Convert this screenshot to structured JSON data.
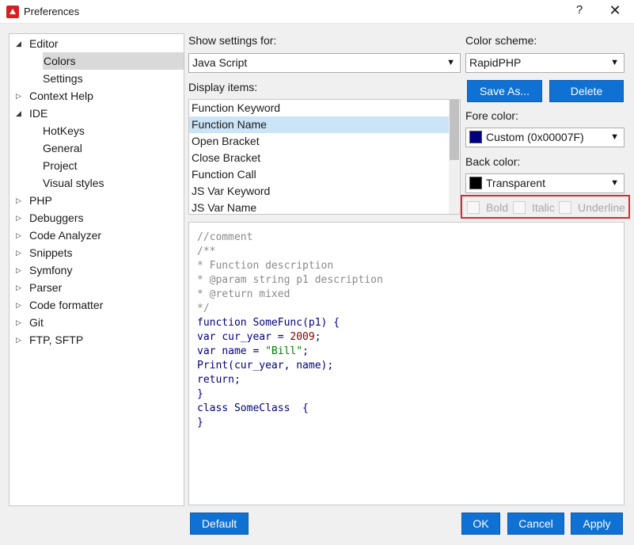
{
  "window": {
    "title": "Preferences",
    "help": "?",
    "close": "✕"
  },
  "tree": [
    {
      "label": "Editor",
      "expanded": true,
      "children": [
        {
          "label": "Colors",
          "selected": true
        },
        {
          "label": "Settings"
        }
      ]
    },
    {
      "label": "Context Help",
      "expanded": false
    },
    {
      "label": "IDE",
      "expanded": true,
      "children": [
        {
          "label": "HotKeys"
        },
        {
          "label": "General"
        },
        {
          "label": "Project"
        },
        {
          "label": "Visual styles"
        }
      ]
    },
    {
      "label": "PHP",
      "expanded": false
    },
    {
      "label": "Debuggers",
      "expanded": false
    },
    {
      "label": "Code Analyzer",
      "expanded": false
    },
    {
      "label": "Snippets",
      "expanded": false
    },
    {
      "label": "Symfony",
      "expanded": false
    },
    {
      "label": "Parser",
      "expanded": false
    },
    {
      "label": "Code formatter",
      "expanded": false
    },
    {
      "label": "Git",
      "expanded": false
    },
    {
      "label": "FTP, SFTP",
      "expanded": false
    }
  ],
  "settings": {
    "show_for_label": "Show settings for:",
    "show_for_value": "Java Script",
    "display_items_label": "Display items:",
    "display_items": [
      "Function Keyword",
      "Function Name",
      "Open Bracket",
      "Close Bracket",
      "Function Call",
      "JS Var Keyword",
      "JS Var Name"
    ],
    "selected_item_index": 1
  },
  "scheme": {
    "label": "Color scheme:",
    "value": "RapidPHP",
    "save_as": "Save As...",
    "delete": "Delete",
    "fore_label": "Fore color:",
    "fore_value": "Custom (0x00007F)",
    "fore_color": "#00007f",
    "back_label": "Back color:",
    "back_value": "Transparent",
    "back_color": "#000000",
    "bold": "Bold",
    "italic": "Italic",
    "underline": "Underline"
  },
  "preview": [
    [
      [
        "comment",
        "//comment"
      ]
    ],
    [
      [
        "comment",
        "/**"
      ]
    ],
    [
      [
        "comment",
        "* Function description"
      ]
    ],
    [
      [
        "comment",
        "* @param string p1 description"
      ]
    ],
    [
      [
        "comment",
        "* @return mixed"
      ]
    ],
    [
      [
        "comment",
        "*/"
      ]
    ],
    [
      [
        "kw",
        "function "
      ],
      [
        "fn",
        "SomeFunc(p1) {"
      ]
    ],
    [
      [
        "kw",
        "var "
      ],
      [
        "plain",
        "cur_year = "
      ],
      [
        "num",
        "2009"
      ],
      [
        "plain",
        ";"
      ]
    ],
    [
      [
        "kw",
        "var "
      ],
      [
        "plain",
        "name = "
      ],
      [
        "str",
        "\"Bill\""
      ],
      [
        "plain",
        ";"
      ]
    ],
    [
      [
        "plain",
        "Print(cur_year, name);"
      ]
    ],
    [
      [
        "kw",
        "return"
      ],
      [
        "plain",
        ";"
      ]
    ],
    [
      [
        "plain",
        "}"
      ]
    ],
    [
      [
        "kw",
        "class "
      ],
      [
        "plain",
        "SomeClass  {"
      ]
    ],
    [
      [
        "plain",
        "}"
      ]
    ]
  ],
  "buttons": {
    "default": "Default",
    "ok": "OK",
    "cancel": "Cancel",
    "apply": "Apply"
  },
  "colors": {
    "accent": "#0f71d3",
    "selection": "#cce4f7",
    "highlight_border": "#e0272d"
  }
}
